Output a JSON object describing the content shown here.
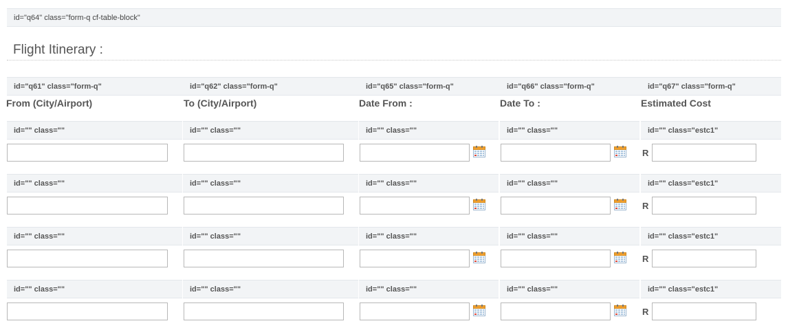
{
  "block_tag": "id=\"q64\" class=\"form-q cf-table-block\"",
  "section_title": "Flight Itinerary :",
  "column_tags": [
    "id=\"q61\" class=\"form-q\"",
    "id=\"q62\" class=\"form-q\"",
    "id=\"q65\" class=\"form-q\"",
    "id=\"q66\" class=\"form-q\"",
    "id=\"q67\" class=\"form-q\""
  ],
  "columns": [
    "From (City/Airport)",
    "To (City/Airport)",
    "Date From :",
    "Date To :",
    "Estimated Cost"
  ],
  "cell_tag_default": "id=\"\" class=\"\"",
  "cell_tag_cost": "id=\"\" class=\"estc1\"",
  "currency_symbol": "R",
  "rows": [
    {
      "from": "",
      "to": "",
      "date_from": "",
      "date_to": "",
      "cost": ""
    },
    {
      "from": "",
      "to": "",
      "date_from": "",
      "date_to": "",
      "cost": ""
    },
    {
      "from": "",
      "to": "",
      "date_from": "",
      "date_to": "",
      "cost": ""
    },
    {
      "from": "",
      "to": "",
      "date_from": "",
      "date_to": "",
      "cost": ""
    }
  ],
  "icons": {
    "date_picker": "calendar-icon"
  },
  "colors": {
    "tag_background": "#f2f4f6",
    "input_border": "#b7b7b7",
    "calendar_header": "#f0a030"
  }
}
